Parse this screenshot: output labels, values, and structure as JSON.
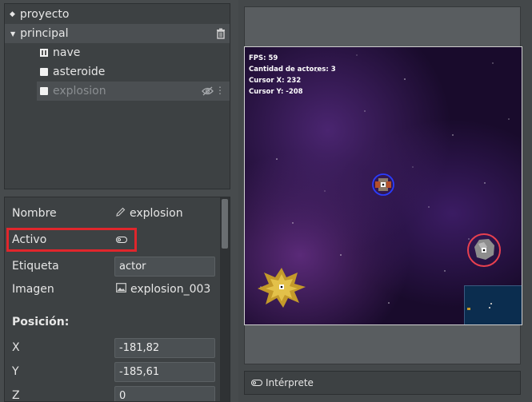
{
  "tree": {
    "project_label": "proyecto",
    "scene_label": "principal",
    "actors": [
      {
        "label": "nave"
      },
      {
        "label": "asteroide"
      },
      {
        "label": "explosion"
      }
    ]
  },
  "properties": {
    "name_label": "Nombre",
    "name_value": "explosion",
    "active_label": "Activo",
    "tag_label": "Etiqueta",
    "tag_value": "actor",
    "image_label": "Imagen",
    "image_value": "explosion_003",
    "position_heading": "Posición:",
    "x_label": "X",
    "x_value": "-181,82",
    "y_label": "Y",
    "y_value": "-185,61",
    "z_label": "Z",
    "z_value": "0"
  },
  "game": {
    "fps": "FPS: 59",
    "actor_count": "Cantidad de actores: 3",
    "cursor_x": "Cursor X: 232",
    "cursor_y": "Cursor Y: -208"
  },
  "console": {
    "label": "Intérprete"
  },
  "icons": {
    "project": "diamond-icon",
    "scene": "triangle-down-icon",
    "delete": "trash-icon",
    "visibility": "eye-off-icon",
    "more": "vertical-dots-icon",
    "edit": "pencil-icon",
    "image": "image-icon",
    "toggle": "toggle-icon"
  },
  "colors": {
    "highlight": "#e0262c",
    "selection_row": "#4b4f52"
  }
}
